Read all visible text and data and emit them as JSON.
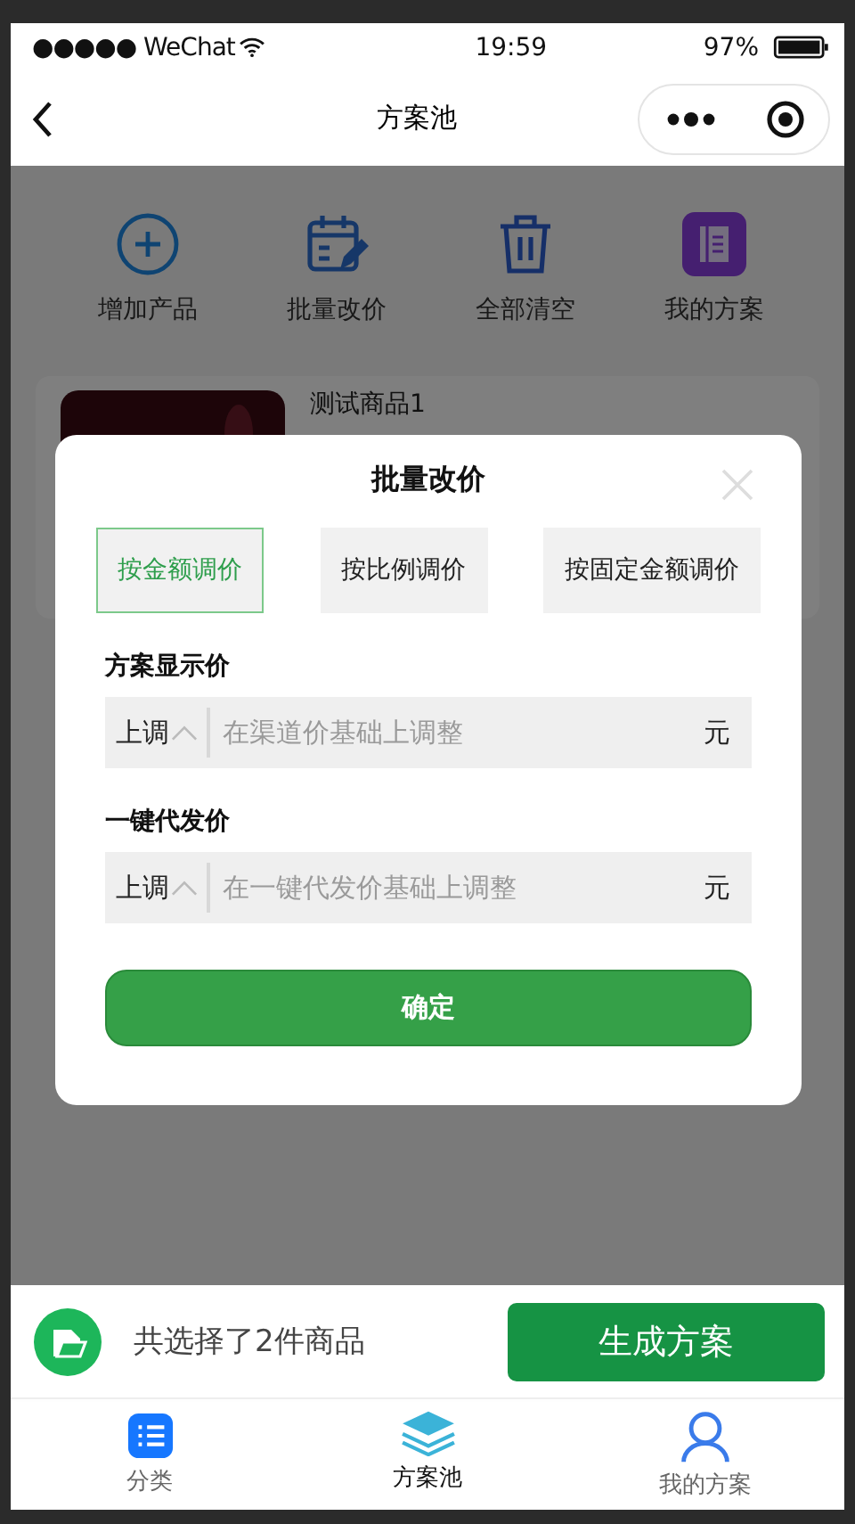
{
  "status_bar": {
    "carrier": "●●●●● WeChat",
    "time": "19:59",
    "battery": "97%"
  },
  "nav": {
    "title": "方案池"
  },
  "toolbar": [
    {
      "kind": "add",
      "label": "增加产品"
    },
    {
      "kind": "edit",
      "label": "批量改价"
    },
    {
      "kind": "trash",
      "label": "全部清空"
    },
    {
      "kind": "book",
      "label": "我的方案"
    }
  ],
  "product": {
    "name": "测试商品1"
  },
  "dialog": {
    "title": "批量改价",
    "modes": [
      {
        "label": "按金额调价",
        "selected": true
      },
      {
        "label": "按比例调价",
        "selected": false
      },
      {
        "label": "按固定金额调价",
        "selected": false
      }
    ],
    "fields": [
      {
        "label": "方案显示价",
        "direction": "上调",
        "placeholder": "在渠道价基础上调整",
        "unit": "元"
      },
      {
        "label": "一键代发价",
        "direction": "上调",
        "placeholder": "在一键代发价基础上调整",
        "unit": "元"
      }
    ],
    "confirm": "确定"
  },
  "summary": {
    "text": "共选择了2件商品",
    "button": "生成方案"
  },
  "tabs": [
    {
      "kind": "list",
      "label": "分类",
      "selected": false
    },
    {
      "kind": "layers",
      "label": "方案池",
      "selected": true
    },
    {
      "kind": "user",
      "label": "我的方案",
      "selected": false
    }
  ]
}
